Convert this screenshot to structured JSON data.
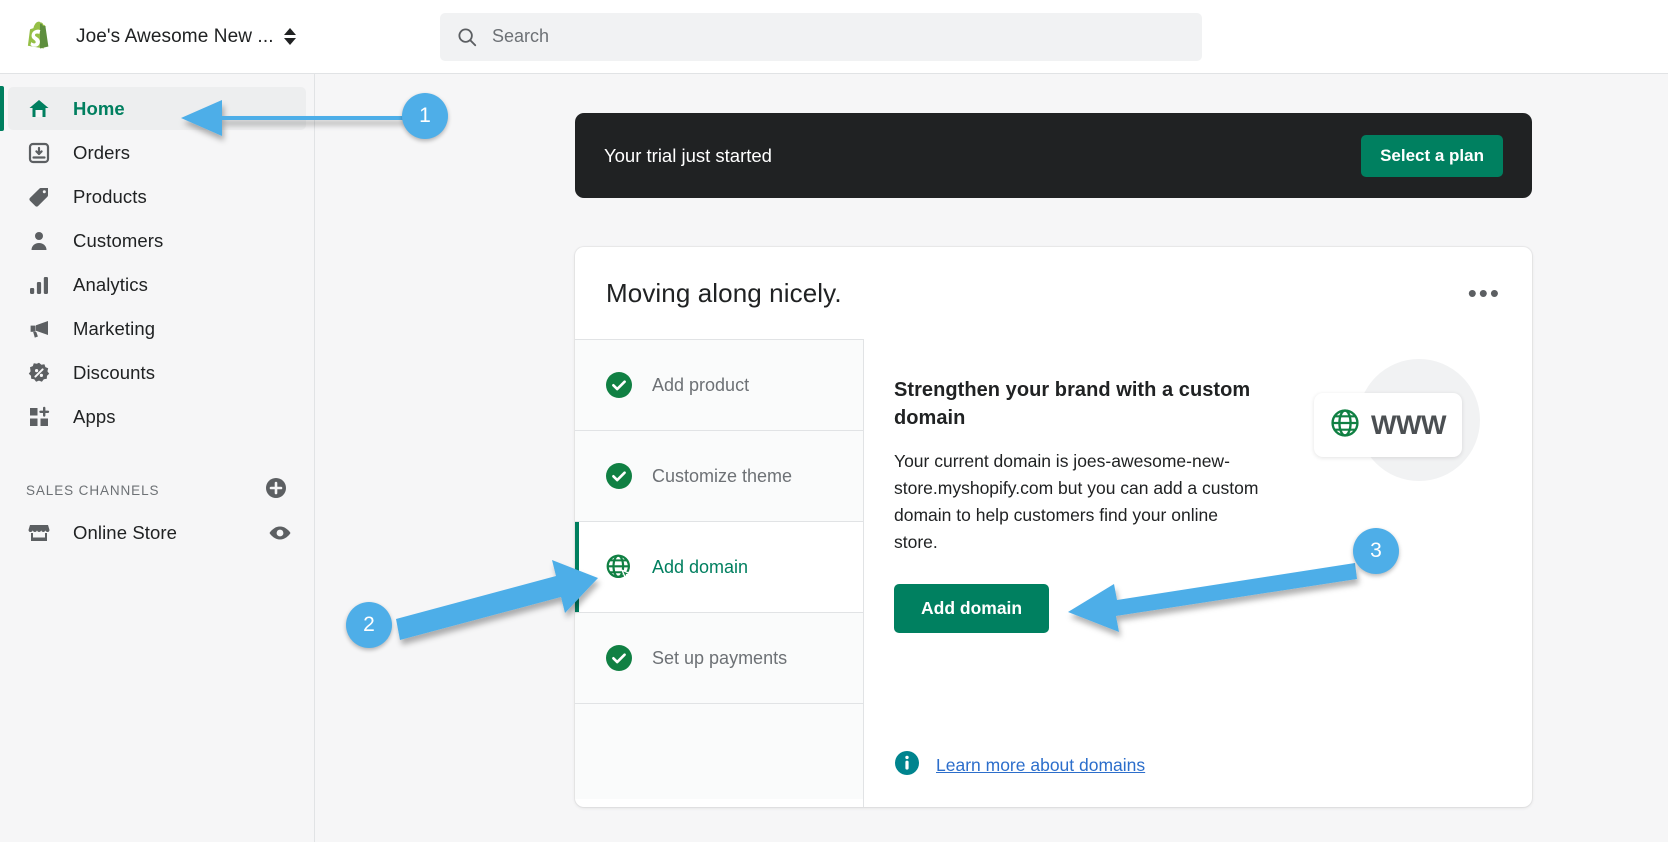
{
  "topbar": {
    "logo_icon": "shopify-bag-logo",
    "store_name": "Joe's Awesome New ...",
    "store_switcher_icon": "updown-chevrons-icon",
    "search": {
      "placeholder": "Search",
      "value": "",
      "icon": "search-icon"
    }
  },
  "sidebar": {
    "items": [
      {
        "label": "Home",
        "icon": "home-icon",
        "active": true
      },
      {
        "label": "Orders",
        "icon": "orders-inbox-icon",
        "active": false
      },
      {
        "label": "Products",
        "icon": "product-tag-icon",
        "active": false
      },
      {
        "label": "Customers",
        "icon": "customer-person-icon",
        "active": false
      },
      {
        "label": "Analytics",
        "icon": "analytics-bars-icon",
        "active": false
      },
      {
        "label": "Marketing",
        "icon": "marketing-megaphone-icon",
        "active": false
      },
      {
        "label": "Discounts",
        "icon": "discount-percent-icon",
        "active": false
      },
      {
        "label": "Apps",
        "icon": "apps-grid-plus-icon",
        "active": false
      }
    ],
    "sales_channels": {
      "title": "SALES CHANNELS",
      "add_icon": "plus-circle-icon",
      "channels": [
        {
          "label": "Online Store",
          "icon": "storefront-icon",
          "action_icon": "eye-view-icon"
        }
      ]
    }
  },
  "main": {
    "trial_banner": {
      "text": "Your trial just started",
      "button": "Select a plan"
    },
    "setup_card": {
      "title": "Moving along nicely.",
      "menu_icon": "ellipsis-icon",
      "checklist": [
        {
          "label": "Add product",
          "state": "complete",
          "icon": "check-circle-icon"
        },
        {
          "label": "Customize theme",
          "state": "complete",
          "icon": "check-circle-icon"
        },
        {
          "label": "Add domain",
          "state": "current",
          "icon": "globe-icon"
        },
        {
          "label": "Set up payments",
          "state": "complete",
          "icon": "check-circle-icon"
        }
      ],
      "detail": {
        "heading": "Strengthen your brand with a custom domain",
        "body": "Your current domain is joes-awesome-new-store.myshopify.com but you can add a custom domain to help customers find your online store.",
        "primary_button": "Add domain",
        "learn_link": "Learn more about domains",
        "learn_icon": "info-circle-icon",
        "illustration": {
          "text": "WWW",
          "icon": "globe-icon"
        }
      }
    }
  },
  "annotations": {
    "accent_color": "#4eaee8",
    "markers": [
      {
        "number": "1",
        "target": "sidebar-item-home"
      },
      {
        "number": "2",
        "target": "checklist-item-add-domain"
      },
      {
        "number": "3",
        "target": "add-domain-button"
      }
    ]
  },
  "colors": {
    "brand_green": "#008060",
    "active_green": "#007f5f",
    "banner_dark": "#202223",
    "link_blue": "#2c6ecb",
    "info_teal": "#00848e"
  }
}
